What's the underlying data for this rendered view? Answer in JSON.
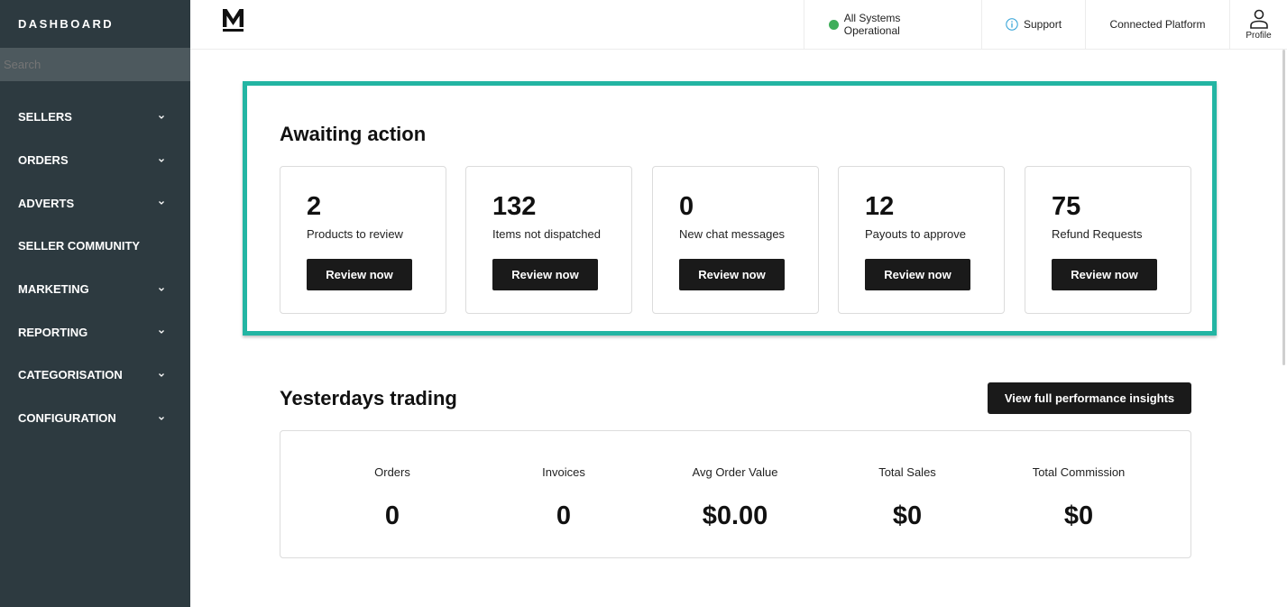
{
  "sidebar": {
    "title": "DASHBOARD",
    "search_placeholder": "Search",
    "items": [
      {
        "label": "SELLERS",
        "has_chevron": true
      },
      {
        "label": "ORDERS",
        "has_chevron": true
      },
      {
        "label": "ADVERTS",
        "has_chevron": true
      },
      {
        "label": "SELLER COMMUNITY",
        "has_chevron": false
      },
      {
        "label": "MARKETING",
        "has_chevron": true
      },
      {
        "label": "REPORTING",
        "has_chevron": true
      },
      {
        "label": "CATEGORISATION",
        "has_chevron": true
      },
      {
        "label": "CONFIGURATION",
        "has_chevron": true
      }
    ]
  },
  "topbar": {
    "logo_icon": "m-logo-icon",
    "status_text": "All Systems Operational",
    "status_color": "#3fae5a",
    "support_label": "Support",
    "platform_label": "Connected Platform",
    "profile_label": "Profile"
  },
  "awaiting": {
    "title": "Awaiting action",
    "highlight_color": "#23b5a3",
    "cards": [
      {
        "count": "2",
        "label": "Products to review",
        "button": "Review now"
      },
      {
        "count": "132",
        "label": "Items not dispatched",
        "button": "Review now"
      },
      {
        "count": "0",
        "label": "New chat messages",
        "button": "Review now"
      },
      {
        "count": "12",
        "label": "Payouts to approve",
        "button": "Review now"
      },
      {
        "count": "75",
        "label": "Refund Requests",
        "button": "Review now"
      }
    ]
  },
  "trading": {
    "title": "Yesterdays trading",
    "insights_button": "View full performance insights",
    "stats": [
      {
        "label": "Orders",
        "value": "0"
      },
      {
        "label": "Invoices",
        "value": "0"
      },
      {
        "label": "Avg Order Value",
        "value": "$0.00"
      },
      {
        "label": "Total Sales",
        "value": "$0"
      },
      {
        "label": "Total Commission",
        "value": "$0"
      }
    ]
  },
  "colors": {
    "sidebar_bg": "#2d3a40",
    "button_bg": "#1a1a1a"
  }
}
